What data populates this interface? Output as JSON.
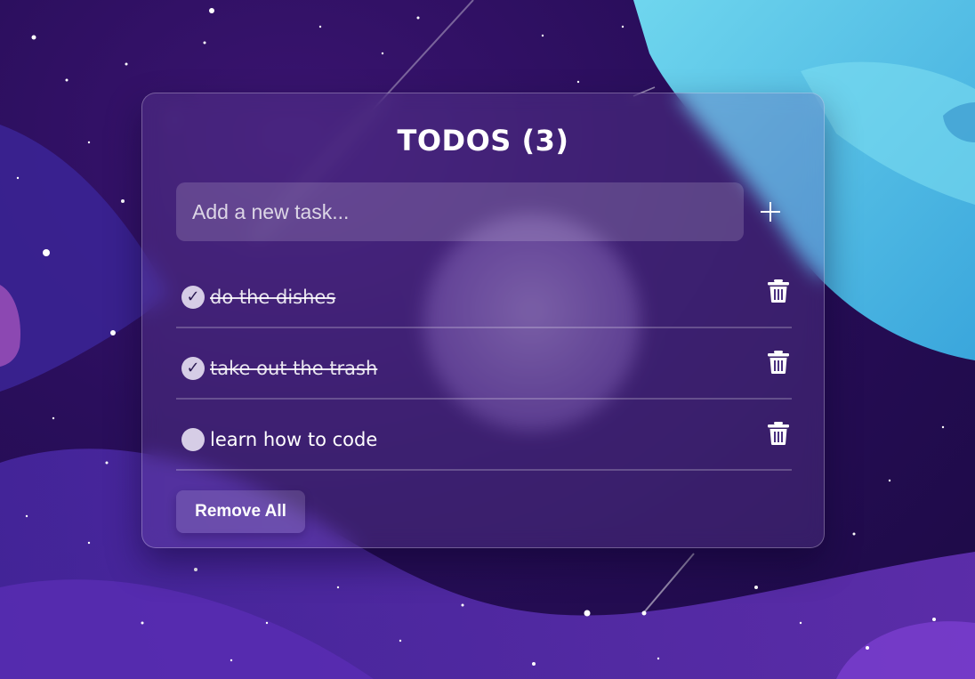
{
  "header": {
    "title": "TODOS (3)"
  },
  "input": {
    "placeholder": "Add a new task...",
    "value": ""
  },
  "add_button": {
    "icon": "plus-icon"
  },
  "todos": [
    {
      "label": "do the dishes",
      "completed": true,
      "check_glyph": "✓",
      "delete_icon": "trash-icon"
    },
    {
      "label": "take out the trash",
      "completed": true,
      "check_glyph": "✓",
      "delete_icon": "trash-icon"
    },
    {
      "label": "learn how to code",
      "completed": false,
      "check_glyph": "",
      "delete_icon": "trash-icon"
    }
  ],
  "footer": {
    "remove_all_label": "Remove All"
  },
  "colors": {
    "background": "#2a0e5c",
    "card": "#6e50aa",
    "planet": "#5fd2ea",
    "check": "#d6cde6",
    "text": "#ffffff"
  }
}
